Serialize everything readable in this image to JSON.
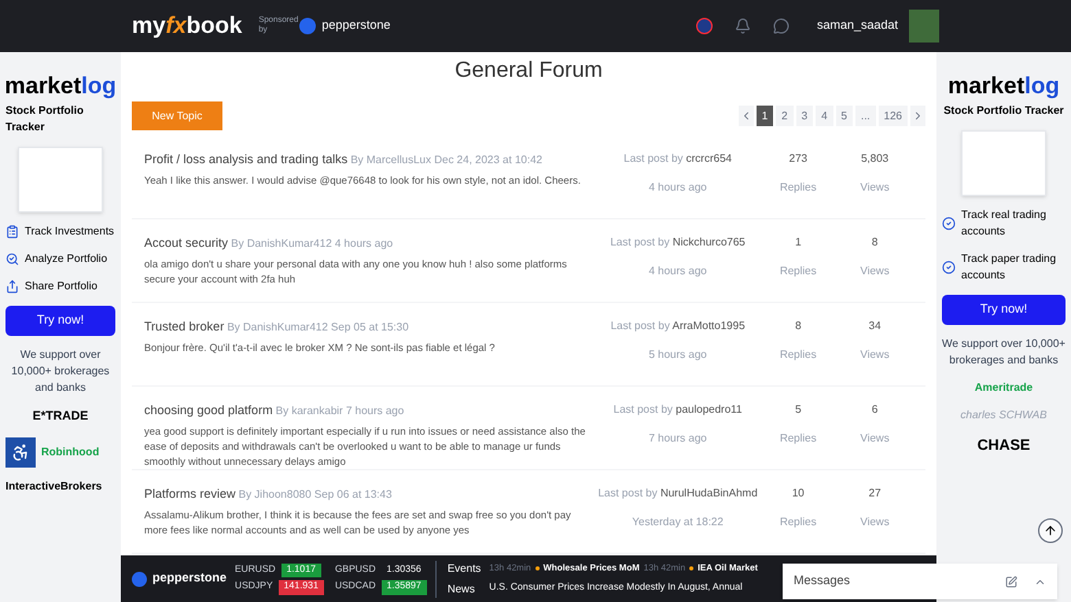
{
  "header": {
    "logo": {
      "part1": "my",
      "part2": "fx",
      "part3": "book"
    },
    "sponsor_label": "Sponsored by",
    "sponsor": "pepperstone",
    "username": "saman_saadat"
  },
  "left_ad": {
    "brand_a": "market",
    "brand_b": "log",
    "tagline": "Stock Portfolio Tracker",
    "features": [
      {
        "kind": "track",
        "label": "Track Investments"
      },
      {
        "kind": "analyze",
        "label": "Analyze Portfolio"
      },
      {
        "kind": "share",
        "label": "Share Portfolio"
      }
    ],
    "button": "Try now!",
    "support": "We support over 10,000+ brokerages and banks",
    "brokers": [
      "E*TRADE",
      "Robinhood",
      "InteractiveBrokers"
    ]
  },
  "forum": {
    "title": "General Forum",
    "new_topic": "New Topic",
    "pages": [
      {
        "label": "1",
        "selected": true
      },
      {
        "label": "2",
        "selected": false
      },
      {
        "label": "3",
        "selected": false
      },
      {
        "label": "4",
        "selected": false
      },
      {
        "label": "5",
        "selected": false
      },
      {
        "label": "...",
        "selected": false
      },
      {
        "label": "126",
        "selected": false
      }
    ],
    "posts": [
      {
        "title": "Profit / loss analysis and trading talks",
        "author": "By MarcellusLux",
        "date": "Dec 24, 2023 at 10:42",
        "excerpt": "Yeah I like this answer. I would advise @que76648 to look for his own style, not an idol. Cheers.",
        "last_by_label": "Last post by",
        "last_by": "crcrcr654",
        "last_time": "4 hours ago",
        "replies": "273",
        "replies_label": "Replies",
        "views": "5,803",
        "views_label": "Views"
      },
      {
        "title": "Accout security",
        "author": "By DanishKumar412",
        "date": "4 hours ago",
        "excerpt": "ola amigo don't u share your personal data with any one you know huh ! also some platforms secure your account with 2fa huh",
        "last_by_label": "Last post by",
        "last_by": "Nickchurco765",
        "last_time": "4 hours ago",
        "replies": "1",
        "replies_label": "Replies",
        "views": "8",
        "views_label": "Views"
      },
      {
        "title": "Trusted broker",
        "author": "By DanishKumar412",
        "date": "Sep 05 at 15:30",
        "excerpt": "Bonjour frère. Qu'il t'a-t-il avec le broker XM ? Ne sont-ils pas fiable et légal ?",
        "last_by_label": "Last post by",
        "last_by": "ArraMotto1995",
        "last_time": "5 hours ago",
        "replies": "8",
        "replies_label": "Replies",
        "views": "34",
        "views_label": "Views"
      },
      {
        "title": "choosing good platform",
        "author": "By karankabir",
        "date": "7 hours ago",
        "excerpt": "yea good support is definitely important especially if u run into issues or need assistance also the ease of deposits and withdrawals can't be overlooked u want to be able to manage ur funds smoothly without unnecessary delays amigo",
        "last_by_label": "Last post by",
        "last_by": "paulopedro11",
        "last_time": "7 hours ago",
        "replies": "5",
        "replies_label": "Replies",
        "views": "6",
        "views_label": "Views"
      },
      {
        "title": "Platforms review",
        "author": "By Jihoon8080",
        "date": "Sep 06 at 13:43",
        "excerpt": "Assalamu-Alikum brother, I think it is because the fees are set and swap free so you don't pay more fees like normal accounts and as well can be used by anyone yes",
        "last_by_label": "Last post by",
        "last_by": "NurulHudaBinAhmd",
        "last_time": "Yesterday at 18:22",
        "replies": "10",
        "replies_label": "Replies",
        "views": "27",
        "views_label": "Views"
      }
    ]
  },
  "right_ad": {
    "brand_a": "market",
    "brand_b": "log",
    "tagline": "Stock Portfolio Tracker",
    "features": [
      "Track real trading accounts",
      "Track paper trading accounts"
    ],
    "button": "Try now!",
    "support": "We support over 10,000+ brokerages and banks",
    "brokers": [
      "Ameritrade",
      "charles SCHWAB",
      "CHASE"
    ]
  },
  "ticker": {
    "brand": "pepperstone",
    "quotes": [
      {
        "pair": "EURUSD",
        "price": "1.1017",
        "color": "#1a9c3e"
      },
      {
        "pair": "USDJPY",
        "price": "141.931",
        "color": "#e0303e"
      },
      {
        "pair": "GBPUSD",
        "price": "1.30356"
      },
      {
        "pair": "USDCAD",
        "price": "1.35897",
        "color": "#1a9c3e"
      }
    ],
    "events_label": "Events",
    "news_label": "News",
    "events": [
      {
        "time": "13h 42min",
        "name": "Wholesale Prices MoM"
      },
      {
        "time": "13h 42min",
        "name": "IEA Oil Market"
      }
    ],
    "news": "U.S. Consumer Prices Increase Modestly In August, Annual"
  },
  "messages": {
    "title": "Messages"
  }
}
